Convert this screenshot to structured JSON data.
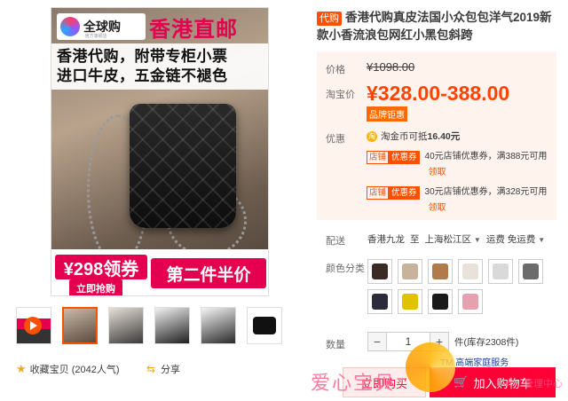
{
  "main_image": {
    "brand_name": "全球购",
    "brand_sub": "·官方旗舰店·",
    "hk_title": "香港直邮",
    "promo_lines": [
      "香港代购，附带专柜小票",
      "进口牛皮，五金链不褪色"
    ],
    "price_tag": "¥298领券",
    "buy_now": "立即抢购",
    "second_half": "第二件半价"
  },
  "favorites": {
    "label": "收藏宝贝 (2042人气)"
  },
  "share": {
    "label": "分享"
  },
  "product": {
    "tag": "代购",
    "title": "香港代购真皮法国小众包包洋气2019新款小香流浪包网红小黑包斜跨"
  },
  "pricing": {
    "price_label": "价格",
    "old_price": "¥1098.00",
    "tb_label": "淘宝价",
    "tb_price": "¥328.00-388.00",
    "brand_discount": "品牌钜惠"
  },
  "offers": {
    "label": "优惠",
    "coin_icon": "淘",
    "coin_text_prefix": "淘金币可抵",
    "coin_amount": "16.40元",
    "coupons": [
      {
        "tag1": "店铺",
        "tag2": "优惠券",
        "text": "40元店铺优惠券，满388元可用",
        "claim": "领取"
      },
      {
        "tag1": "店铺",
        "tag2": "优惠券",
        "text": "30元店铺优惠券，满328元可用",
        "claim": "领取"
      }
    ]
  },
  "shipping": {
    "label": "配送",
    "from": "香港九龙",
    "to_word": "至",
    "to": "上海松江区",
    "fee_label": "运费",
    "fee": "免运费"
  },
  "colors": {
    "label": "颜色分类",
    "swatches": [
      "#3a2b24",
      "#c7b39c",
      "#b07a4a",
      "#e9e2da",
      "#d9d9d9",
      "#6b6b6b",
      "#2b2b3c",
      "#e0c200",
      "#1a1a1a",
      "#e6a1b0"
    ]
  },
  "quantity": {
    "label": "数量",
    "value": "1",
    "stock": "件(库存2308件)"
  },
  "service": {
    "text": "TM 高端家庭服务"
  },
  "actions": {
    "buy_now": "立即购买",
    "add_to_cart": "加入购物车"
  },
  "watermark": {
    "text": "爱心宝贝",
    "text2": "管理中心"
  }
}
